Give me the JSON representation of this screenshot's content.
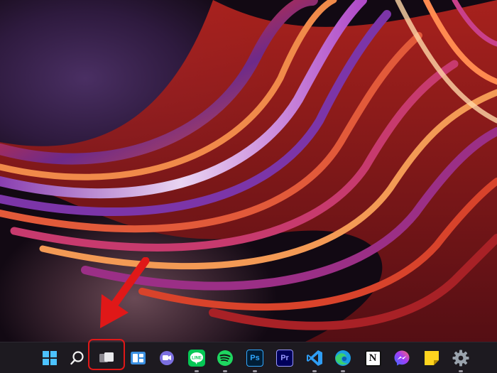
{
  "desktop": {
    "wallpaper": "abstract-swirl-wallpaper"
  },
  "annotation": {
    "arrow": "red-arrow",
    "highlight": "task-view-highlight",
    "color": "#e01818"
  },
  "taskbar": {
    "icons": [
      {
        "name": "start",
        "icon": "windows-logo-icon",
        "running": false
      },
      {
        "name": "search",
        "icon": "search-icon",
        "running": false
      },
      {
        "name": "task-view",
        "icon": "task-view-icon",
        "running": false
      },
      {
        "name": "widgets",
        "icon": "widgets-icon",
        "running": false
      },
      {
        "name": "teams-chat",
        "icon": "teams-chat-icon",
        "running": false
      },
      {
        "name": "line",
        "icon": "line-icon",
        "label": "LINE",
        "running": true
      },
      {
        "name": "spotify",
        "icon": "spotify-icon",
        "running": true
      },
      {
        "name": "photoshop",
        "icon": "photoshop-icon",
        "label": "Ps",
        "running": true
      },
      {
        "name": "premiere-pro",
        "icon": "premiere-pro-icon",
        "label": "Pr",
        "running": false
      },
      {
        "name": "vs-code",
        "icon": "vs-code-icon",
        "running": true
      },
      {
        "name": "edge",
        "icon": "edge-icon",
        "running": true
      },
      {
        "name": "notion",
        "icon": "notion-icon",
        "label": "N",
        "running": false
      },
      {
        "name": "messenger",
        "icon": "messenger-icon",
        "running": false
      },
      {
        "name": "sticky-notes",
        "icon": "sticky-notes-icon",
        "running": false
      },
      {
        "name": "settings",
        "icon": "gear-icon",
        "running": true
      }
    ]
  }
}
